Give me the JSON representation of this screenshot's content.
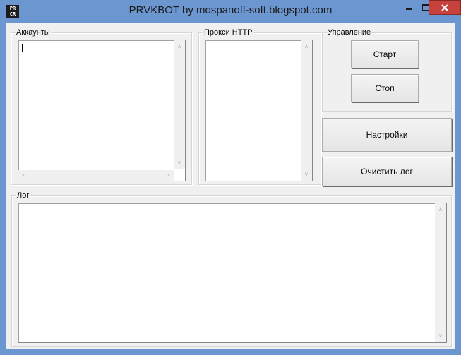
{
  "window": {
    "icon_text_top": "PR",
    "icon_text_bottom": "CR",
    "title": "PRVKBOT by mospanoff-soft.blogspot.com"
  },
  "accounts": {
    "label": "Аккаунты",
    "value": ""
  },
  "proxy": {
    "label": "Прокси HTTP",
    "value": ""
  },
  "control": {
    "label": "Управление",
    "start_label": "Старт",
    "stop_label": "Стоп"
  },
  "settings_label": "Настройки",
  "clear_log_label": "Очистить лог",
  "log": {
    "label": "Лог",
    "value": ""
  },
  "colors": {
    "titlebar": "#6b96d0",
    "close": "#c7413d",
    "client": "#f0f0f0"
  },
  "icons": {
    "minimize": "minimize-icon",
    "maximize": "maximize-icon",
    "close": "close-icon"
  }
}
